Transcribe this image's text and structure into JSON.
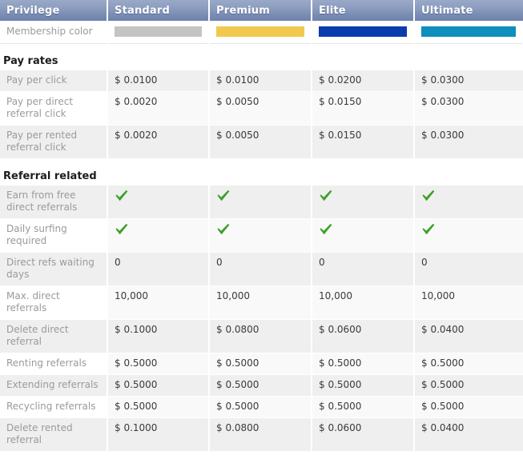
{
  "table": {
    "columns": [
      "Privilege",
      "Standard",
      "Premium",
      "Elite",
      "Ultimate"
    ],
    "membership_color_row": {
      "label": "Membership color",
      "colors": [
        "#c4c4c4",
        "#f1c94f",
        "#0b3cad",
        "#0e8ebd"
      ]
    },
    "sections": [
      {
        "title": "Pay rates",
        "rows": [
          {
            "label": "Pay per click",
            "values": [
              "$ 0.0100",
              "$ 0.0100",
              "$ 0.0200",
              "$ 0.0300"
            ]
          },
          {
            "label": "Pay per direct referral click",
            "values": [
              "$ 0.0020",
              "$ 0.0050",
              "$ 0.0150",
              "$ 0.0300"
            ]
          },
          {
            "label": "Pay per rented referral click",
            "values": [
              "$ 0.0020",
              "$ 0.0050",
              "$ 0.0150",
              "$ 0.0300"
            ]
          }
        ]
      },
      {
        "title": "Referral related",
        "rows": [
          {
            "label": "Earn from free direct referrals",
            "values": [
              "check",
              "check",
              "check",
              "check"
            ],
            "type": "check"
          },
          {
            "label": "Daily surfing required",
            "values": [
              "check",
              "check",
              "check",
              "check"
            ],
            "type": "check"
          },
          {
            "label": "Direct refs waiting days",
            "values": [
              "0",
              "0",
              "0",
              "0"
            ]
          },
          {
            "label": "Max. direct referrals",
            "values": [
              "10,000",
              "10,000",
              "10,000",
              "10,000"
            ]
          },
          {
            "label": "Delete direct referral",
            "values": [
              "$ 0.1000",
              "$ 0.0800",
              "$ 0.0600",
              "$ 0.0400"
            ]
          },
          {
            "label": "Renting referrals",
            "values": [
              "$ 0.5000",
              "$ 0.5000",
              "$ 0.5000",
              "$ 0.5000"
            ]
          },
          {
            "label": "Extending referrals",
            "values": [
              "$ 0.5000",
              "$ 0.5000",
              "$ 0.5000",
              "$ 0.5000"
            ]
          },
          {
            "label": "Recycling referrals",
            "values": [
              "$ 0.5000",
              "$ 0.5000",
              "$ 0.5000",
              "$ 0.5000"
            ]
          },
          {
            "label": "Delete rented referral",
            "values": [
              "$ 0.1000",
              "$ 0.0800",
              "$ 0.0600",
              "$ 0.0400"
            ]
          }
        ]
      }
    ],
    "check_icon": "check-mark-icon",
    "check_color": "#3ea02a"
  }
}
